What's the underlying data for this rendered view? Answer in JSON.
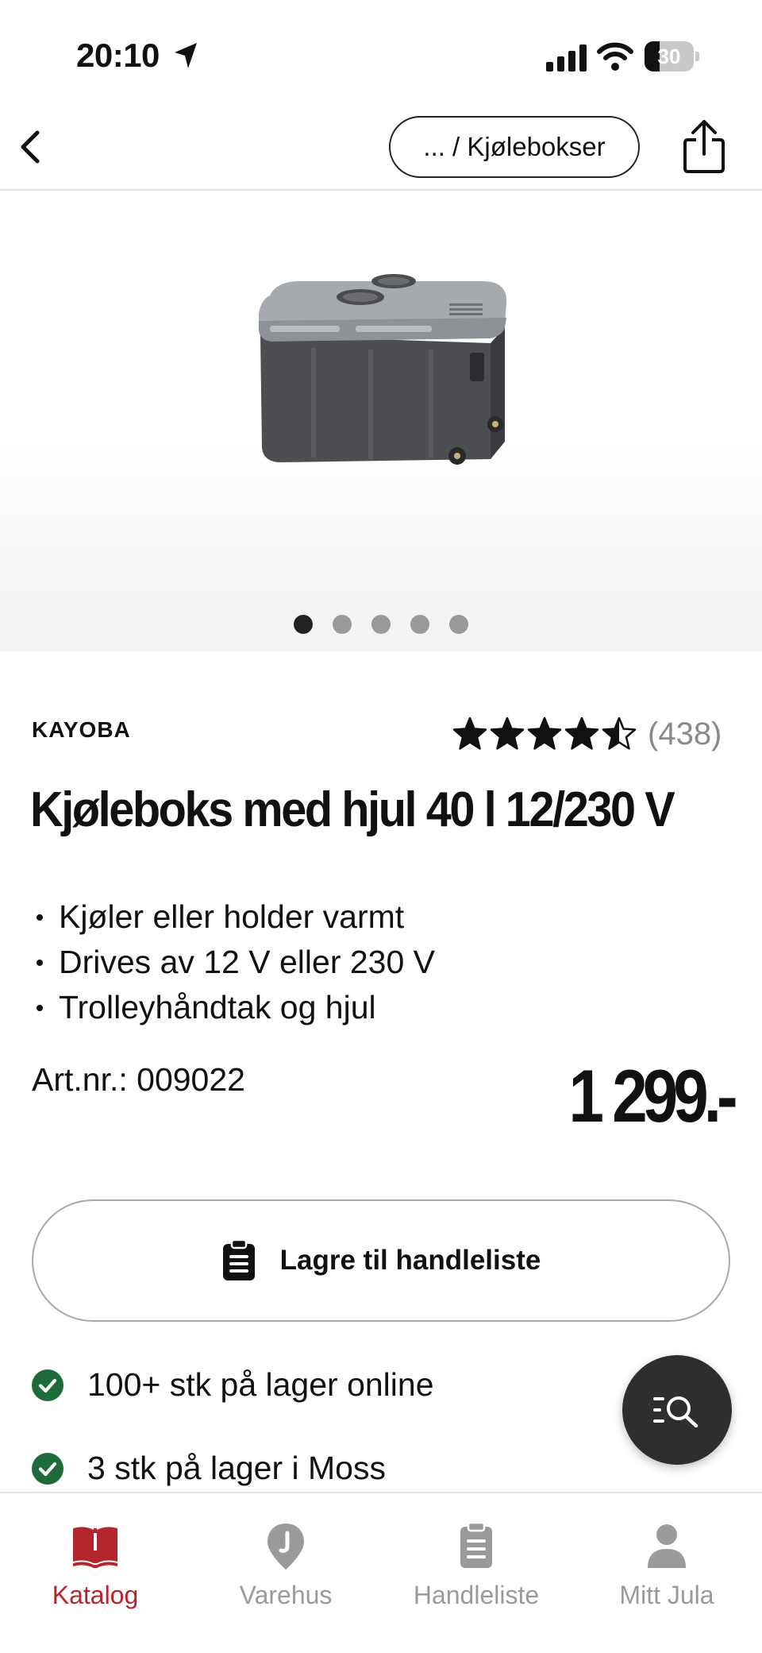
{
  "status_bar": {
    "time": "20:10",
    "battery_level": "30",
    "battery_fraction": 0.3
  },
  "header": {
    "breadcrumb": "... / Kjølebokser",
    "back_icon": "chevron-left-icon",
    "share_icon": "share-icon"
  },
  "gallery": {
    "image_count": 5,
    "active_index": 0
  },
  "product": {
    "brand": "KAYOBA",
    "rating_value": 4.5,
    "rating_count": "(438)",
    "title": "Kjøleboks med hjul 40 l 12/230 V",
    "bullets": [
      "Kjøler eller holder varmt",
      "Drives av 12 V eller 230 V",
      "Trolleyhåndtak og hjul"
    ],
    "article_number": "Art.nr.: 009022",
    "price": "1 299.-"
  },
  "actions": {
    "save_label": "Lagre til handleliste"
  },
  "stock": {
    "online": "100+ stk på lager online",
    "store": "3 stk på lager i Moss"
  },
  "tabs": [
    {
      "label": "Katalog",
      "icon": "catalog-book-icon",
      "active": true
    },
    {
      "label": "Varehus",
      "icon": "store-pin-icon",
      "active": false
    },
    {
      "label": "Handleliste",
      "icon": "clipboard-list-icon",
      "active": false
    },
    {
      "label": "Mitt Jula",
      "icon": "user-icon",
      "active": false
    }
  ],
  "colors": {
    "accent": "#b3262d",
    "stock_check": "#1f6b3a",
    "fab": "#2e2e2e"
  }
}
